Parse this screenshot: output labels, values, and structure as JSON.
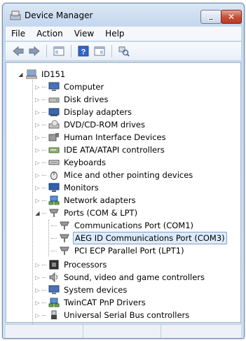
{
  "window": {
    "title": "Device Manager",
    "close_glyph": "✕"
  },
  "menu": [
    "File",
    "Action",
    "View",
    "Help"
  ],
  "toolbar": {
    "buttons": [
      "back-icon",
      "forward-icon",
      "properties-pane-icon",
      "help-icon",
      "console-pane-icon",
      "scan-hardware-icon"
    ]
  },
  "tree": {
    "root": "ID151",
    "categories": [
      "Computer",
      "Disk drives",
      "Display adapters",
      "DVD/CD-ROM drives",
      "Human Interface Devices",
      "IDE ATA/ATAPI controllers",
      "Keyboards",
      "Mice and other pointing devices",
      "Monitors",
      "Network adapters",
      "Ports (COM & LPT)",
      "Processors",
      "Sound, video and game controllers",
      "System devices",
      "TwinCAT PnP Drivers",
      "Universal Serial Bus controllers"
    ],
    "ports_children": [
      "Communications Port (COM1)",
      "AEG ID Communications Port (COM3)",
      "PCI ECP Parallel Port (LPT1)"
    ],
    "selected": "AEG ID Communications Port (COM3)"
  }
}
